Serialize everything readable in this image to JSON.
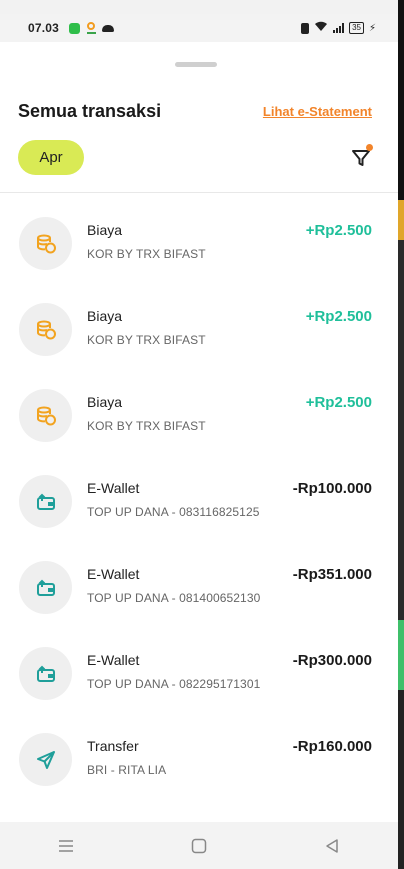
{
  "statusbar": {
    "time": "07.03",
    "battery": "35"
  },
  "header": {
    "title": "Semua transaksi",
    "estatement_link": "Lihat e-Statement",
    "month_filter": "Apr"
  },
  "colors": {
    "accent_orange": "#f2842a",
    "chip_lime": "#d9ea55",
    "income_green": "#1fbf9a"
  },
  "transactions": [
    {
      "icon": "coin-stack-icon",
      "title": "Biaya",
      "subtitle": "KOR BY TRX BIFAST",
      "amount": "+Rp2.500"
    },
    {
      "icon": "coin-stack-icon",
      "title": "Biaya",
      "subtitle": "KOR BY TRX BIFAST",
      "amount": "+Rp2.500"
    },
    {
      "icon": "coin-stack-icon",
      "title": "Biaya",
      "subtitle": "KOR BY TRX BIFAST",
      "amount": "+Rp2.500"
    },
    {
      "icon": "wallet-topup-icon",
      "title": "E-Wallet",
      "subtitle": "TOP UP DANA - 083116825125",
      "amount": "-Rp100.000"
    },
    {
      "icon": "wallet-topup-icon",
      "title": "E-Wallet",
      "subtitle": "TOP UP DANA - 081400652130",
      "amount": "-Rp351.000"
    },
    {
      "icon": "wallet-topup-icon",
      "title": "E-Wallet",
      "subtitle": "TOP UP DANA - 082295171301",
      "amount": "-Rp300.000"
    },
    {
      "icon": "send-icon",
      "title": "Transfer",
      "subtitle": "BRI - RITA LIA",
      "amount": "-Rp160.000"
    }
  ],
  "navigation": [
    "menu-icon",
    "home-icon",
    "back-icon"
  ]
}
